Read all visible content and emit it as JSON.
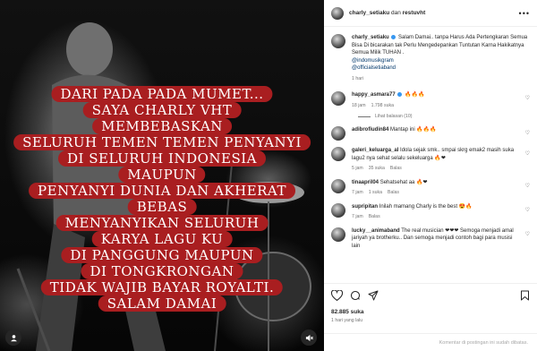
{
  "post": {
    "overlay_lines": [
      "Dari Pada Pada Mumet...",
      "Saya Charly VHT",
      "Membebaskan",
      "Seluruh Temen Temen Penyanyi",
      "di Seluruh Indonesia",
      "Maupun",
      "Penyanyi Dunia Dan akherat",
      "Bebas",
      "Menyanyikan Seluruh",
      "Karya Lagu ku",
      "di Panggung Maupun",
      "di Tongkrongan",
      "Tidak  Wajib Bayar Royalti.",
      "Salam Damai"
    ]
  },
  "header": {
    "username": "charly_setiaku",
    "joiner": "dan",
    "collaborator": "restuvht",
    "more": "•••"
  },
  "caption": {
    "username": "charly_setiaku",
    "text": "Salam Damai.. tanpa Harus Ada Pertengkaran Semua Bisa Di bicarakan tak Perlu Mengedepankan Tuntutan Karna Hakikatnya Semua Milik TUHAN .",
    "mention1": "@indomusikgram",
    "mention2": "@officialsetiaband",
    "time": "1 hari"
  },
  "comments": [
    {
      "username": "happy_asmara77",
      "text": "🔥🔥🔥",
      "time": "18 jam",
      "likes": "1.798 suka",
      "replies": "Lihat balasan (10)"
    },
    {
      "username": "adibrofiudin84",
      "text": "Mantap ini 🔥🔥🔥",
      "time": "",
      "likes": ""
    },
    {
      "username": "galeri_keluarga_al",
      "text": "Idola sejak smk.. smpai skrg emak2 masih suka lagu2 nya sehat selalu sekeluarga 🔥❤",
      "time": "5 jam",
      "likes": "35 suka",
      "reply": "Balas"
    },
    {
      "username": "tinaapril04",
      "text": "Sehatsehat aa 🔥❤",
      "time": "7 jam",
      "likes": "1 suka",
      "reply": "Balas"
    },
    {
      "username": "supripitan",
      "text": "Inilah mamang Charly is the best 😍🔥",
      "time": "7 jam",
      "likes": "",
      "reply": "Balas"
    },
    {
      "username": "lucky__animaband",
      "text": "The real musician ❤❤❤ Semoga menjadi amal jariyah ya brotherku.. Dan semoga menjadi contoh bagi para musisi lain",
      "time": "",
      "likes": ""
    }
  ],
  "stats": {
    "likes": "82.885 suka",
    "posted": "1 hari yang lalu"
  },
  "comment_bar": {
    "text": "Komentar di postingan ini sudah dibatas."
  }
}
